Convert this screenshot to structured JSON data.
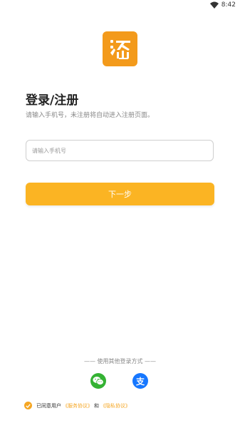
{
  "status": {
    "time": "8:42"
  },
  "login": {
    "title": "登录/注册",
    "subtitle": "请输入手机号，未注册将自动进入注册页面。",
    "phone_placeholder": "请输入手机号",
    "next_label": "下一步"
  },
  "other_login": {
    "label": "—— 使用其他登录方式 ——",
    "alipay_glyph": "支"
  },
  "agreement": {
    "prefix": "已同意用户",
    "service_link": "《服务协议》",
    "and": "和",
    "privacy_link": "《隐私协议》"
  },
  "colors": {
    "accent": "#fbb423",
    "logo": "#f39a1b",
    "wechat": "#34b233",
    "alipay": "#1677ff"
  }
}
